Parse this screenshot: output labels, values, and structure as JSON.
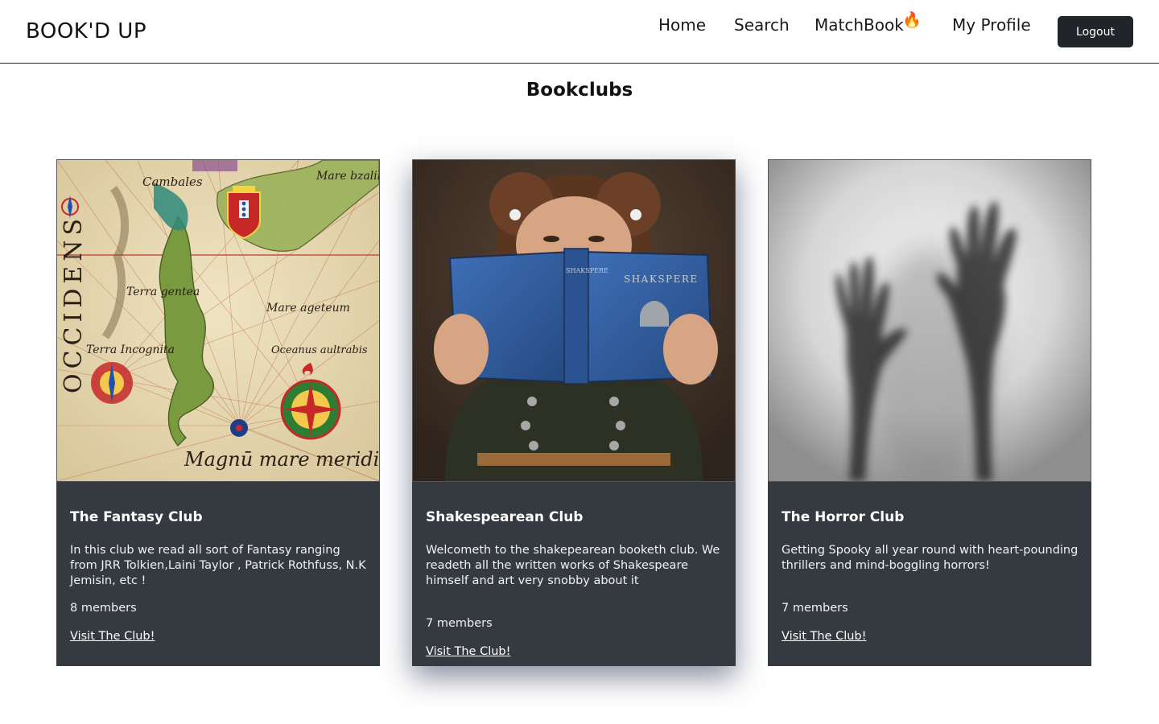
{
  "header": {
    "brand": "BOOK'D UP",
    "nav": [
      {
        "label": "Home"
      },
      {
        "label": "Search"
      },
      {
        "label": "MatchBook",
        "badge": "🔥"
      },
      {
        "label": "My Profile"
      }
    ],
    "logout_label": "Logout"
  },
  "page": {
    "title": "Bookclubs"
  },
  "clubs": [
    {
      "name": "The Fantasy Club",
      "description": "In this club we read all sort of Fantasy ranging from JRR Tolkien,Laini Taylor , Patrick Rothfuss, N.K Jemisin, etc !",
      "members": "8 members",
      "link": "Visit The Club!",
      "image_text": {
        "top_left": "Cambales",
        "top_right": "Mare bzalile",
        "left_vertical": "OCCIDENS",
        "land": "Terra gentea",
        "mid": "Mare ageteum",
        "incognita": "Terra Incognita",
        "oceanus": "Oceanus aultrabis",
        "bottom": "Magnū mare meridio"
      }
    },
    {
      "name": "Shakespearean Club",
      "description": "Welcometh to the shakepearean booketh club. We readeth all the written works of Shakespeare himself and art very snobby about it",
      "members": "7 members",
      "link": "Visit The Club!",
      "image_text": {
        "cover": "SHAKSPERE",
        "spine": "SHAKSPERE"
      }
    },
    {
      "name": "The Horror Club",
      "description": "Getting Spooky all year round with heart-pounding thrillers and mind-boggling horrors!",
      "members": "7 members",
      "link": "Visit The Club!",
      "image_text": {}
    }
  ]
}
